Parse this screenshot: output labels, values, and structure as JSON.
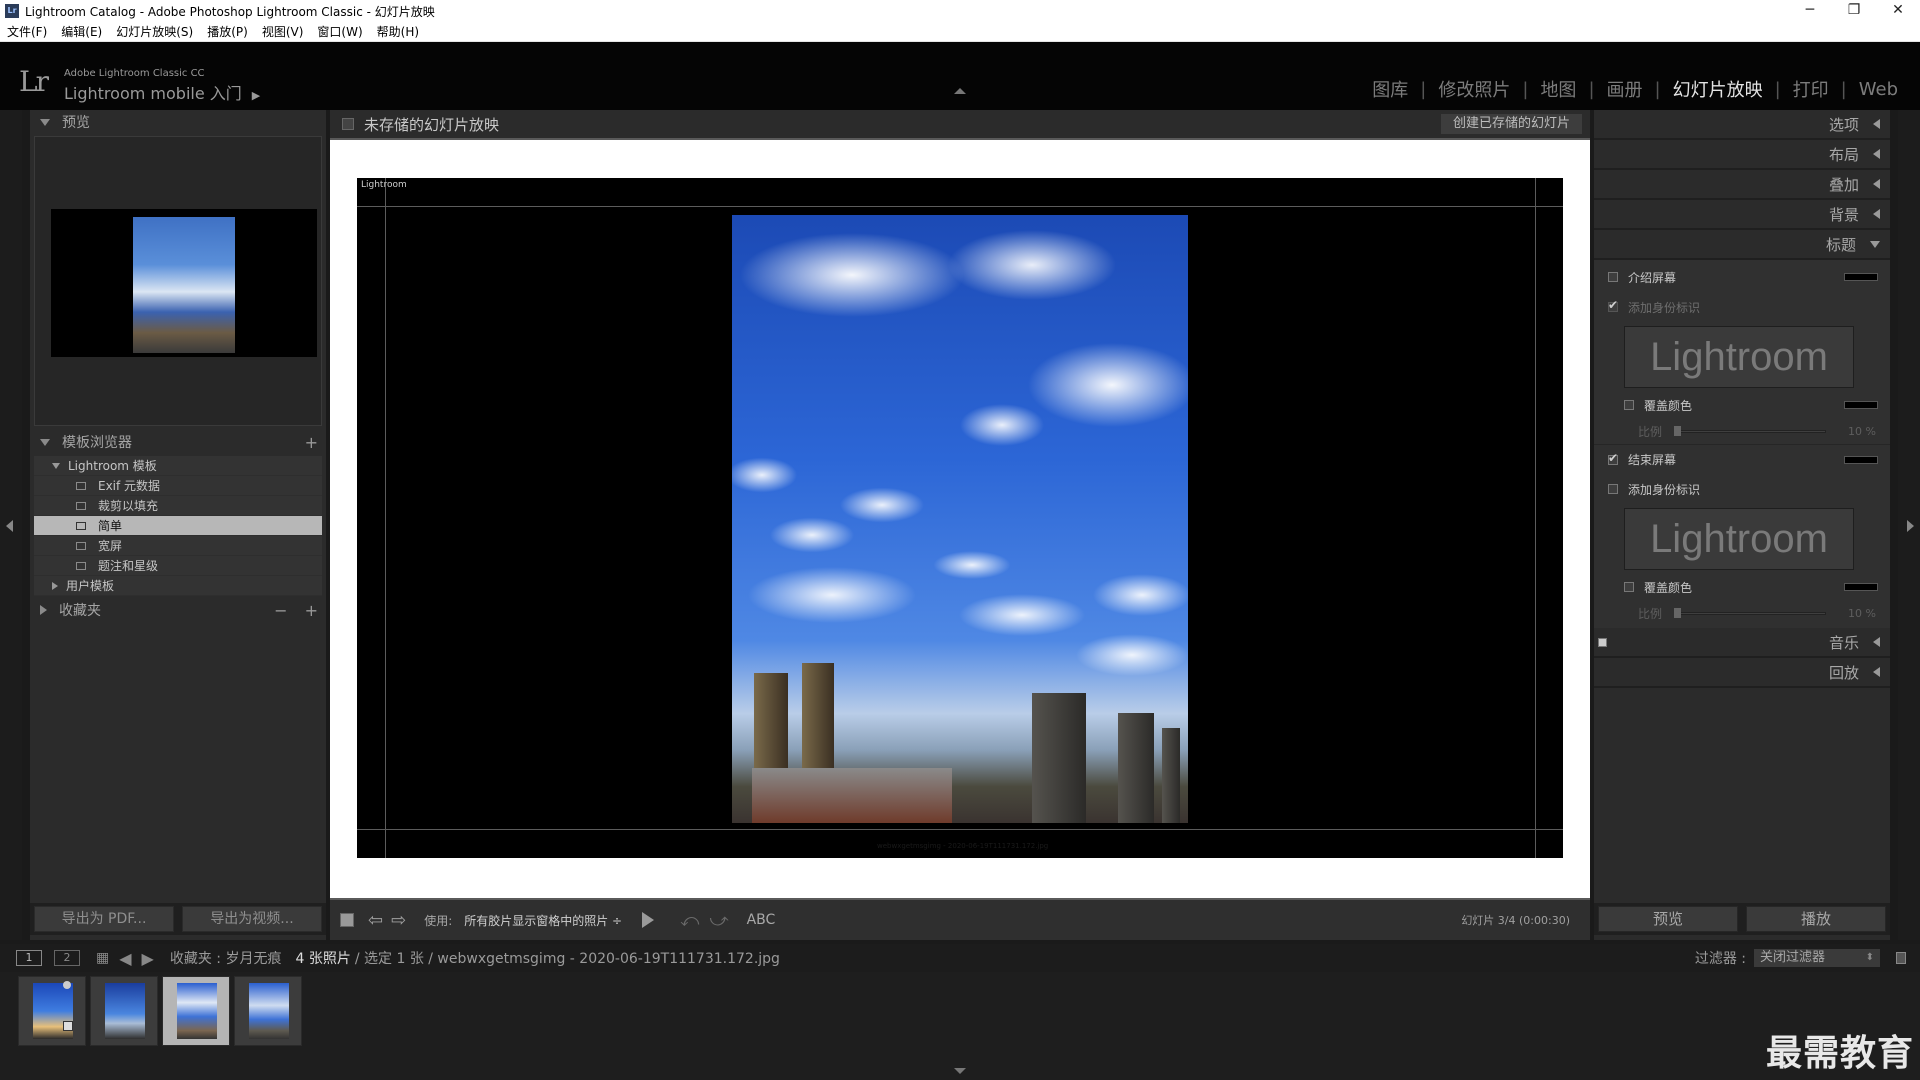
{
  "window": {
    "title": "Lightroom Catalog - Adobe Photoshop Lightroom Classic - 幻灯片放映",
    "app_icon": "Lr",
    "controls": [
      "─",
      "❐",
      "✕"
    ]
  },
  "menu": [
    "文件(F)",
    "编辑(E)",
    "幻灯片放映(S)",
    "播放(P)",
    "视图(V)",
    "窗口(W)",
    "帮助(H)"
  ],
  "identity": {
    "logo": "Lr",
    "line1": "Adobe Lightroom Classic CC",
    "line2": "Lightroom mobile 入门",
    "arrow": "▶"
  },
  "modules": [
    {
      "label": "图库",
      "active": false
    },
    {
      "label": "修改照片",
      "active": false
    },
    {
      "label": "地图",
      "active": false
    },
    {
      "label": "画册",
      "active": false
    },
    {
      "label": "幻灯片放映",
      "active": true
    },
    {
      "label": "打印",
      "active": false
    },
    {
      "label": "Web",
      "active": false
    }
  ],
  "left": {
    "preview_title": "预览",
    "template_browser_title": "模板浏览器",
    "template_add": "+",
    "lightroom_templates": "Lightroom 模板",
    "templates": [
      {
        "label": "Exif 元数据",
        "selected": false
      },
      {
        "label": "裁剪以填充",
        "selected": false
      },
      {
        "label": "简单",
        "selected": true
      },
      {
        "label": "宽屏",
        "selected": false
      },
      {
        "label": "题注和星级",
        "selected": false
      }
    ],
    "user_templates": "用户模板",
    "collections_title": "收藏夹",
    "collections_minus": "−",
    "collections_plus": "+",
    "export_pdf": "导出为 PDF...",
    "export_video": "导出为视频..."
  },
  "center": {
    "title": "未存储的幻灯片放映",
    "create_saved": "创建已存储的幻灯片",
    "identity_small": "Lightroom",
    "filename_caption": "webwxgetmsgimg - 2020-06-19T111731.172.jpg",
    "toolbar": {
      "use_label": "使用:",
      "use_value": "所有胶片显示窗格中的照片 ÷",
      "abc": "ABC",
      "count": "幻灯片 3/4 (0:00:30)",
      "prev": "⇦",
      "next": "⇨",
      "rot_left": "⤺",
      "rot_right": "⤻"
    }
  },
  "right": {
    "sections_collapsed_top": [
      "选项",
      "布局",
      "叠加",
      "背景"
    ],
    "titles_section": "标题",
    "intro_screen": "介绍屏幕",
    "intro_checked": false,
    "add_identity_1": "添加身份标识",
    "add_identity_1_checked": true,
    "identity_plate_1": "Lightroom",
    "override_color_1": "覆盖颜色",
    "scale_label": "比例",
    "scale_value": "10 %",
    "scale_fraction": 0.1,
    "ending_screen": "结束屏幕",
    "ending_checked": true,
    "add_identity_2": "添加身份标识",
    "add_identity_2_checked": false,
    "identity_plate_2": "Lightroom",
    "override_color_2": "覆盖颜色",
    "sections_collapsed_bottom": [
      "音乐",
      "回放"
    ],
    "preview_button": "预览",
    "play_button": "播放"
  },
  "filmbar": {
    "screen1": "1",
    "screen2": "2",
    "collection": "收藏夹 : 岁月无痕",
    "photo_count": "4 张照片",
    "selection": "/ 选定 1 张 / webwxgetmsgimg - 2020-06-19T111731.172.jpg",
    "filter_label": "过滤器 :",
    "filter_value": "关闭过滤器"
  },
  "filmstrip": {
    "selected_index": 2,
    "count": 4
  },
  "watermark": "最需教育",
  "colors": {
    "panel_bg": "#2b2b2b",
    "selected_row": "#b7b7b7",
    "active_module": "#e4e4e4"
  }
}
